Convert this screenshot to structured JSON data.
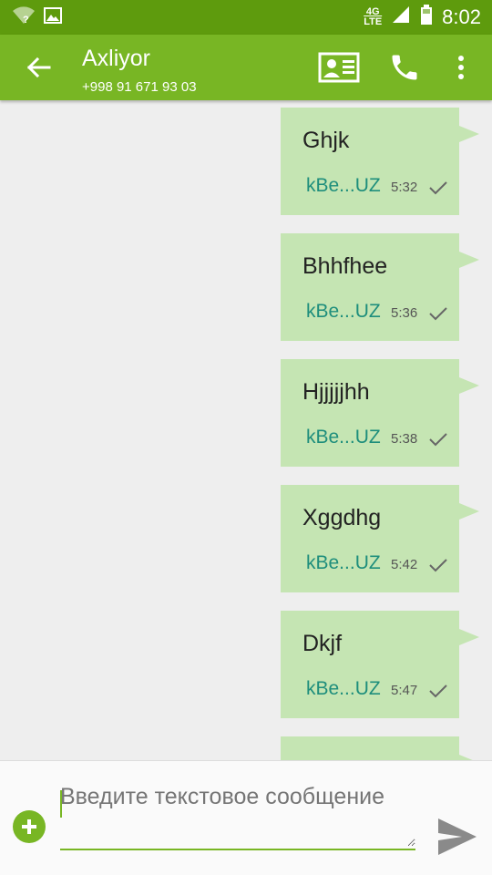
{
  "status_bar": {
    "network_label": "4G",
    "network_sub": "LTE",
    "time": "8:02",
    "icons": [
      "wifi-icon",
      "image-icon",
      "signal-icon",
      "battery-icon"
    ]
  },
  "header": {
    "title": "Axliyor",
    "subtitle": "+998 91 671 93 03",
    "icons": [
      "back-arrow-icon",
      "contact-card-icon",
      "phone-icon",
      "more-vert-icon"
    ]
  },
  "messages": [
    {
      "text": "Ghjk",
      "sender": "kBe...UZ",
      "time": "5:32"
    },
    {
      "text": "Bhhfhee",
      "sender": "kBe...UZ",
      "time": "5:36"
    },
    {
      "text": "Hjjjjjhh",
      "sender": "kBe...UZ",
      "time": "5:38"
    },
    {
      "text": "Xggdhg",
      "sender": "kBe...UZ",
      "time": "5:42"
    },
    {
      "text": "Dkjf",
      "sender": "kBe...UZ",
      "time": "5:47"
    }
  ],
  "composer": {
    "placeholder": "Введите текстовое сообщение"
  },
  "colors": {
    "status_bar": "#5e9b0d",
    "app_bar": "#78b624",
    "bubble": "#c5e5b3",
    "sender": "#1e8e7c",
    "background": "#eeeeee"
  }
}
